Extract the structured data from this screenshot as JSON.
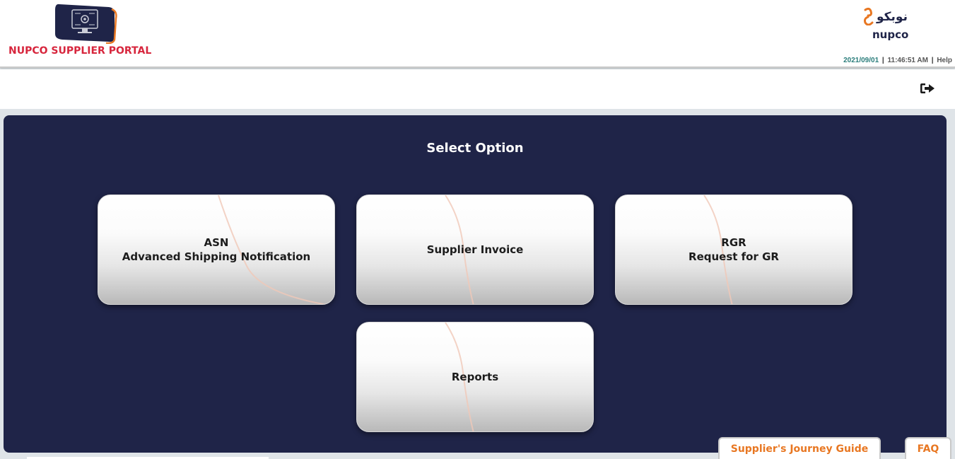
{
  "header": {
    "portal_title": "NUPCO SUPPLIER PORTAL",
    "brand_arabic": "نوبكو",
    "brand_latin": "nupco",
    "date": "2021/09/01",
    "time": "11:46:51 AM",
    "separator": "|",
    "help_label": "Help"
  },
  "toolbar": {
    "logout_icon": "sign-out-icon"
  },
  "main": {
    "title": "Select Option",
    "options": [
      {
        "line1": "ASN",
        "line2": "Advanced Shipping Notification"
      },
      {
        "line1": "Supplier Invoice"
      },
      {
        "line1": "RGR",
        "line2": "Request for GR"
      },
      {
        "line1": "Reports"
      }
    ]
  },
  "footer": {
    "guide_label": "Supplier's Journey Guide",
    "faq_label": "FAQ"
  },
  "colors": {
    "panel_bg": "#1f2448",
    "brand_red": "#d7263d",
    "accent_orange": "#e87722",
    "date_teal": "#2a7d7b"
  }
}
